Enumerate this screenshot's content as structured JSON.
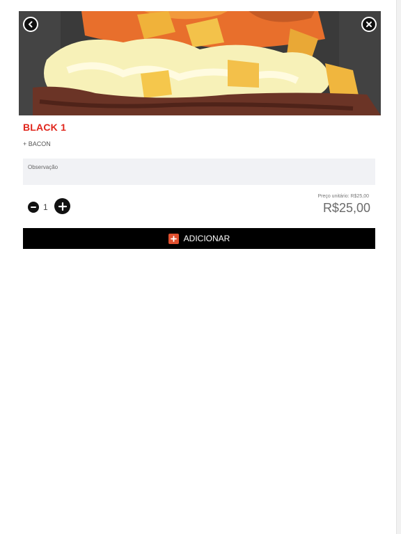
{
  "product": {
    "name": "BLACK 1",
    "extras": "+ BACON"
  },
  "observation": {
    "placeholder": "Observação",
    "value": ""
  },
  "quantity": {
    "value": "1",
    "minus_icon": "minus-circle-icon",
    "plus_icon": "plus-circle-icon"
  },
  "pricing": {
    "unit_price_label": "Preço unitário: R$25,00",
    "total": "R$25,00"
  },
  "actions": {
    "add_label": "ADICIONAR",
    "add_icon": "plus-square-icon",
    "back_icon": "back-arrow-icon",
    "close_icon": "close-icon"
  },
  "colors": {
    "title": "#e0251b",
    "button_bg": "#000000",
    "add_icon_bg": "#e0502f"
  }
}
